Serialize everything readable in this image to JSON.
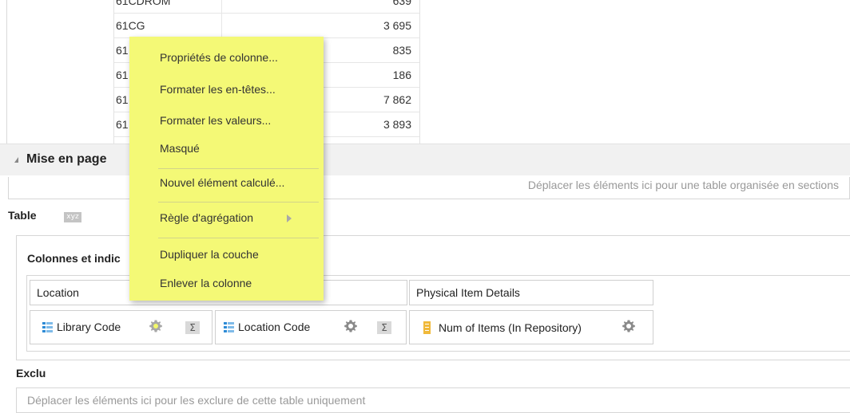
{
  "preview_table": {
    "rows": [
      {
        "code": "61CDROM",
        "value": "639"
      },
      {
        "code": "61CG",
        "value": "3 695"
      },
      {
        "code": "61",
        "value": "835"
      },
      {
        "code": "61",
        "value": "186"
      },
      {
        "code": "61",
        "value": "7 862"
      },
      {
        "code": "61",
        "value": "3 893"
      }
    ]
  },
  "layout_section": {
    "title": "Mise en page",
    "sections_drop_hint": "Déplacer les éléments ici pour une table organisée en sections",
    "table_label": "Table",
    "table_icon_text": "xyz",
    "columns_label": "Colonnes et indic",
    "groups": [
      {
        "label": "Location"
      },
      {
        "label": "Physical Item Details"
      }
    ],
    "columns": [
      {
        "label": "Library Code",
        "icon": "dimension-icon"
      },
      {
        "label": "Location Code",
        "icon": "dimension-icon"
      },
      {
        "label": "Num of Items (In Repository)",
        "icon": "measure-icon"
      }
    ],
    "sigma_symbol": "Σ",
    "excluded_label": "Exclu",
    "excluded_hint": "Déplacer les éléments ici pour les exclure de cette table uniquement"
  },
  "context_menu": {
    "items": [
      "Propriétés de colonne...",
      "Formater les en-têtes...",
      "Formater les valeurs...",
      "Masqué",
      "Nouvel élément calculé...",
      "Règle d'agrégation",
      "Dupliquer la couche",
      "Enlever la colonne"
    ]
  },
  "colors": {
    "highlight": "#f4f976",
    "dimension_icon": "#2e8bd6",
    "measure_icon": "#f0b93a",
    "gear": "#8a8a8a"
  }
}
